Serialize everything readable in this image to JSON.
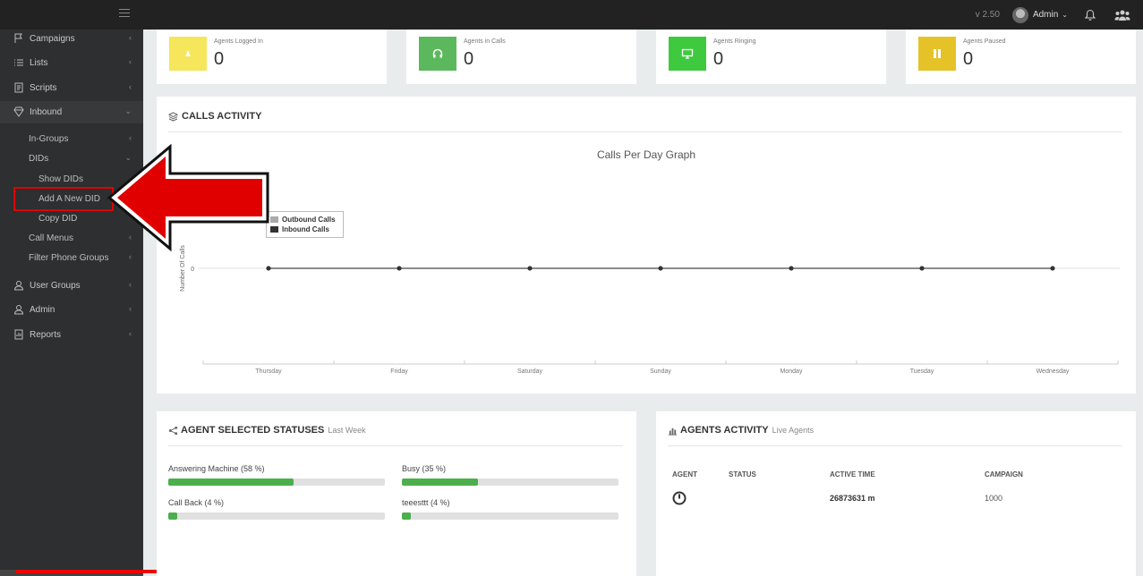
{
  "topbar": {
    "version": "v 2.50",
    "user_name": "Admin"
  },
  "sidebar": {
    "items": [
      {
        "label": "Campaigns"
      },
      {
        "label": "Lists"
      },
      {
        "label": "Scripts"
      },
      {
        "label": "Inbound"
      },
      {
        "label": "User Groups"
      },
      {
        "label": "Admin"
      },
      {
        "label": "Reports"
      }
    ],
    "inbound_sub": [
      {
        "label": "In-Groups"
      },
      {
        "label": "DIDs"
      },
      {
        "label": "Show DIDs"
      },
      {
        "label": "Add A New DID"
      },
      {
        "label": "Copy DID"
      },
      {
        "label": "Call Menus"
      },
      {
        "label": "Filter Phone Groups"
      }
    ]
  },
  "cards": [
    {
      "label": "Agents Logged In",
      "value": "0",
      "color": "#f5e65c",
      "icon": "bulb-icon"
    },
    {
      "label": "Agents in Calls",
      "value": "0",
      "color": "#5cb85c",
      "icon": "headset-icon"
    },
    {
      "label": "Agents Ringing",
      "value": "0",
      "color": "#3fc93f",
      "icon": "monitor-icon"
    },
    {
      "label": "Agents Paused",
      "value": "0",
      "color": "#e6c229",
      "icon": "pause-icon"
    }
  ],
  "calls_activity": {
    "title": "CALLS ACTIVITY"
  },
  "chart_data": {
    "type": "line",
    "title": "Calls Per Day Graph",
    "xlabel": "",
    "ylabel": "Number Of Calls",
    "categories": [
      "Thursday",
      "Friday",
      "Saturday",
      "Sunday",
      "Monday",
      "Tuesday",
      "Wednesday"
    ],
    "series": [
      {
        "name": "Outbound Calls",
        "values": [
          0,
          0,
          0,
          0,
          0,
          0,
          0
        ],
        "color": "#aaaaaa"
      },
      {
        "name": "Inbound Calls",
        "values": [
          0,
          0,
          0,
          0,
          0,
          0,
          0
        ],
        "color": "#333333"
      }
    ],
    "y_ticks": [
      "0"
    ],
    "legend": "top-left"
  },
  "agent_statuses": {
    "title": "AGENT SELECTED STATUSES",
    "subtitle": "Last Week",
    "items": [
      {
        "label": "Answering Machine (58 %)",
        "percent": 58
      },
      {
        "label": "Busy (35 %)",
        "percent": 35
      },
      {
        "label": "Call Back (4 %)",
        "percent": 4
      },
      {
        "label": "teeesttt (4 %)",
        "percent": 4
      }
    ]
  },
  "agents_activity": {
    "title": "AGENTS ACTIVITY",
    "subtitle": "Live Agents",
    "columns": [
      "AGENT",
      "STATUS",
      "ACTIVE TIME",
      "CAMPAIGN"
    ],
    "rows": [
      {
        "agent_icon": "power-icon",
        "status": "",
        "active_time": "26873631 m",
        "campaign": "1000"
      }
    ]
  },
  "annotation": {
    "arrow_color": "#e00000",
    "box_color": "#e00000"
  }
}
